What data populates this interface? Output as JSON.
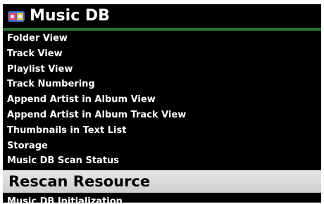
{
  "header": {
    "title": "Music DB",
    "icon": "music-db-icon"
  },
  "menu": {
    "items": [
      {
        "label": "Folder View",
        "selected": false
      },
      {
        "label": "Track View",
        "selected": false
      },
      {
        "label": "Playlist View",
        "selected": false
      },
      {
        "label": "Track Numbering",
        "selected": false
      },
      {
        "label": "Append Artist in Album View",
        "selected": false
      },
      {
        "label": "Append Artist in Album Track View",
        "selected": false
      },
      {
        "label": "Thumbnails in Text List",
        "selected": false
      },
      {
        "label": "Storage",
        "selected": false
      },
      {
        "label": "Music DB Scan Status",
        "selected": false
      },
      {
        "label": "Rescan Resource",
        "selected": true
      },
      {
        "label": "Music DB Initialization",
        "selected": false
      }
    ]
  },
  "colors": {
    "background": "#000000",
    "accent": "#2f7a3a",
    "selection": "#d9d9d9"
  }
}
